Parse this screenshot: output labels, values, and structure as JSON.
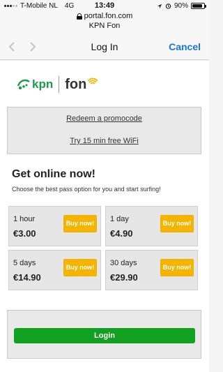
{
  "status_bar": {
    "carrier": "T-Mobile NL",
    "network": "4G",
    "time": "13:49",
    "battery_percent": "90%",
    "battery_level": 0.9
  },
  "browser": {
    "url": "portal.fon.com",
    "site_name": "KPN Fon"
  },
  "nav": {
    "title": "Log In",
    "cancel_label": "Cancel",
    "back_icon": "chevron-left-icon",
    "forward_icon": "chevron-right-icon"
  },
  "logo": {
    "brand_left": "kpn",
    "brand_right": "fon"
  },
  "promo": {
    "redeem_label": "Redeem a promocode",
    "free_wifi_label": "Try 15 min free WiFi"
  },
  "main": {
    "headline": "Get online now!",
    "subheadline": "Choose the best pass option for you and start surfing!"
  },
  "passes": [
    {
      "duration": "1 hour",
      "price": "€3.00",
      "button_label": "Buy now!"
    },
    {
      "duration": "1 day",
      "price": "€4.90",
      "button_label": "Buy now!"
    },
    {
      "duration": "5 days",
      "price": "€14.90",
      "button_label": "Buy now!"
    },
    {
      "duration": "30 days",
      "price": "€29.90",
      "button_label": "Buy now!"
    }
  ],
  "login": {
    "button_label": "Login"
  },
  "colors": {
    "accent_blue": "#1a73e8",
    "buy_button": "#f5b400",
    "login_button": "#12a020",
    "kpn_green": "#1b9c4a"
  }
}
